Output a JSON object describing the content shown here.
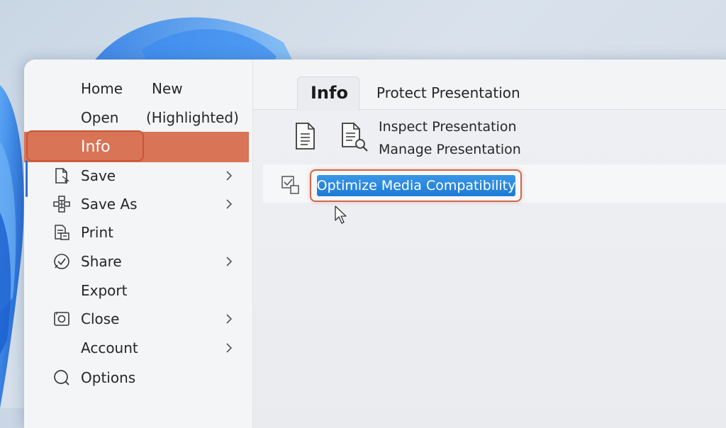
{
  "sidebar": {
    "top_left": [
      "Home",
      "Open"
    ],
    "top_right": [
      "New",
      "(Highlighted)"
    ],
    "selected": "Info",
    "items": [
      {
        "label": "Save",
        "icon": "save-icon",
        "chevron": true
      },
      {
        "label": "Save As",
        "icon": "save-as-icon",
        "chevron": true
      },
      {
        "label": "Print",
        "icon": "print-icon",
        "chevron": false
      },
      {
        "label": "Share",
        "icon": "share-icon",
        "chevron": true
      },
      {
        "label": "Export",
        "icon": "",
        "chevron": false
      },
      {
        "label": "Close",
        "icon": "close-icon",
        "chevron": true
      },
      {
        "label": "Account",
        "icon": "",
        "chevron": true
      },
      {
        "label": "Options",
        "icon": "options-icon",
        "chevron": false
      }
    ]
  },
  "tabs": {
    "active": "Info",
    "other": "Protect Presentation"
  },
  "actions": {
    "inspect": "Inspect Presentation",
    "manage": "Manage Presentation",
    "optimize": "Optimize Media Compatibility"
  },
  "colors": {
    "highlight": "#d97456",
    "outline": "#c85636",
    "button": "#1c7ad6",
    "accent": "#2f6fd0"
  }
}
